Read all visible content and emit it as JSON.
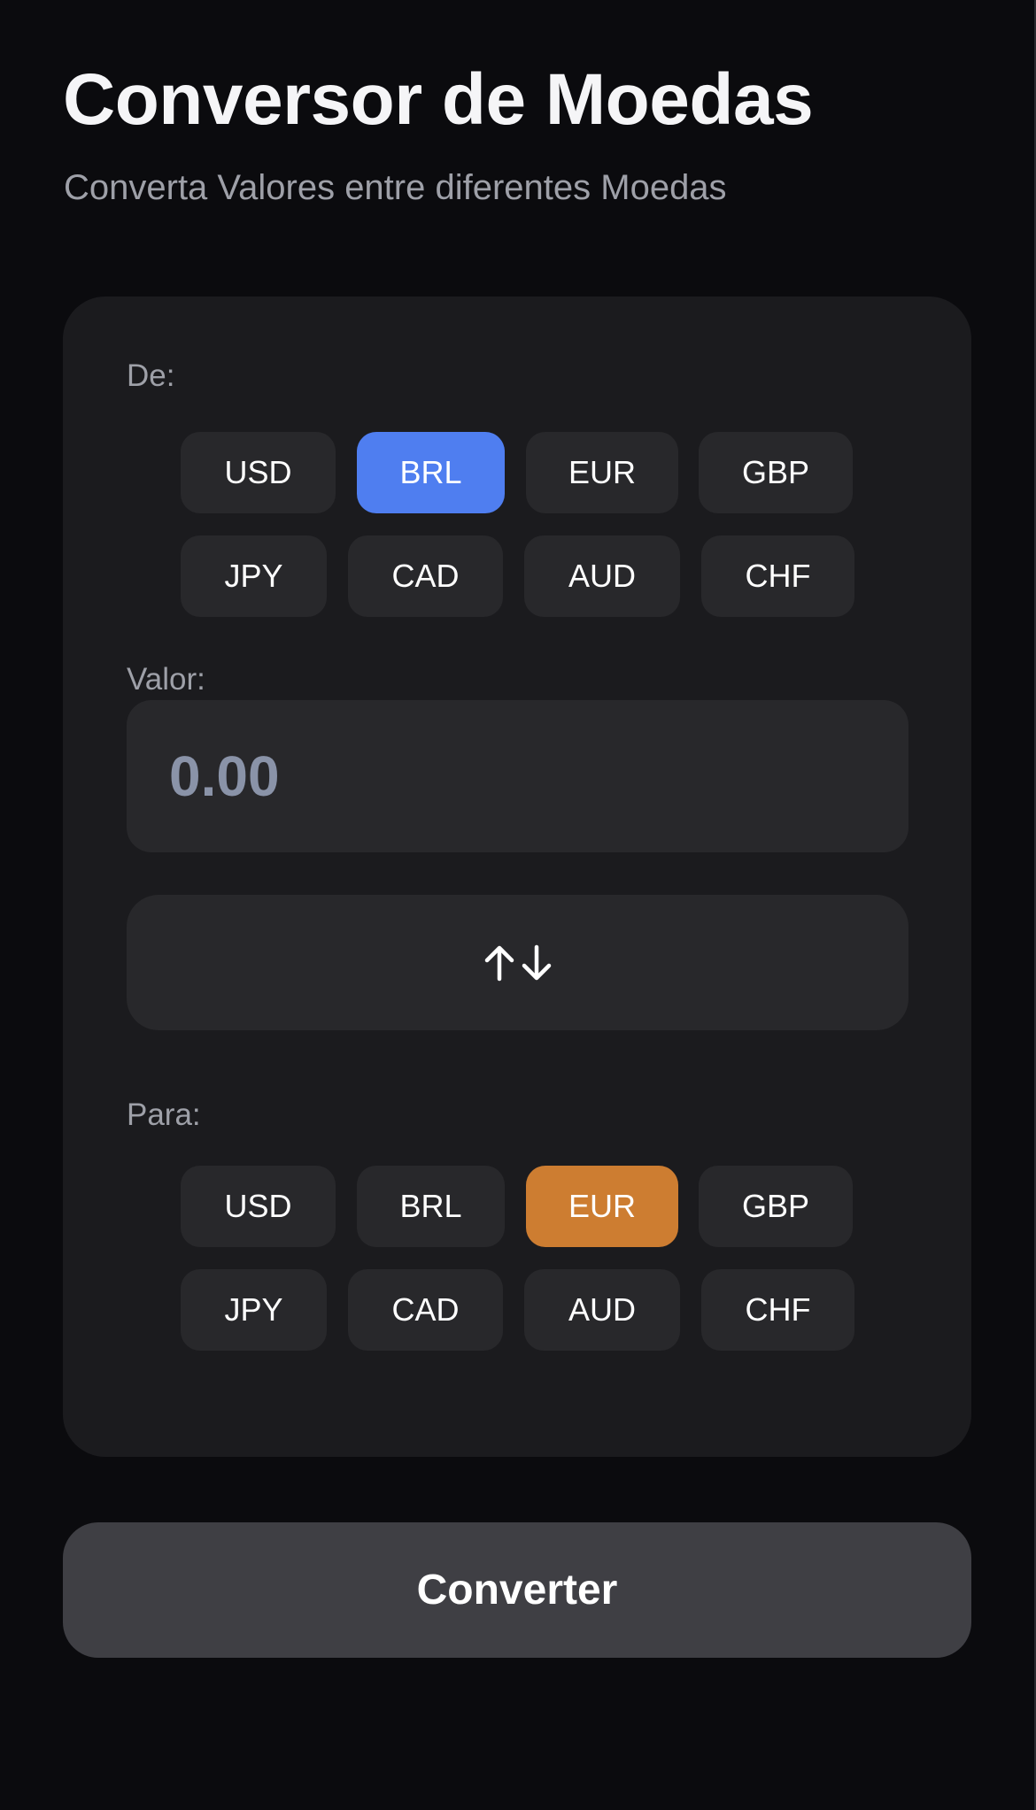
{
  "header": {
    "title": "Conversor de Moedas",
    "subtitle": "Converta Valores entre diferentes Moedas"
  },
  "from": {
    "label": "De:",
    "currencies": [
      "USD",
      "BRL",
      "EUR",
      "GBP",
      "JPY",
      "CAD",
      "AUD",
      "CHF"
    ],
    "selected": "BRL",
    "selected_color": "#4f7ef0"
  },
  "amount": {
    "label": "Valor:",
    "placeholder": "0.00",
    "value": ""
  },
  "swap": {
    "icon": "swap-vertical-arrows-icon"
  },
  "to": {
    "label": "Para:",
    "currencies": [
      "USD",
      "BRL",
      "EUR",
      "GBP",
      "JPY",
      "CAD",
      "AUD",
      "CHF"
    ],
    "selected": "EUR",
    "selected_color": "#cd7d31"
  },
  "actions": {
    "convert_label": "Converter"
  },
  "colors": {
    "background": "#0b0b0e",
    "card": "#1b1b1e",
    "chip": "#28282b",
    "button": "#3f3f44"
  }
}
